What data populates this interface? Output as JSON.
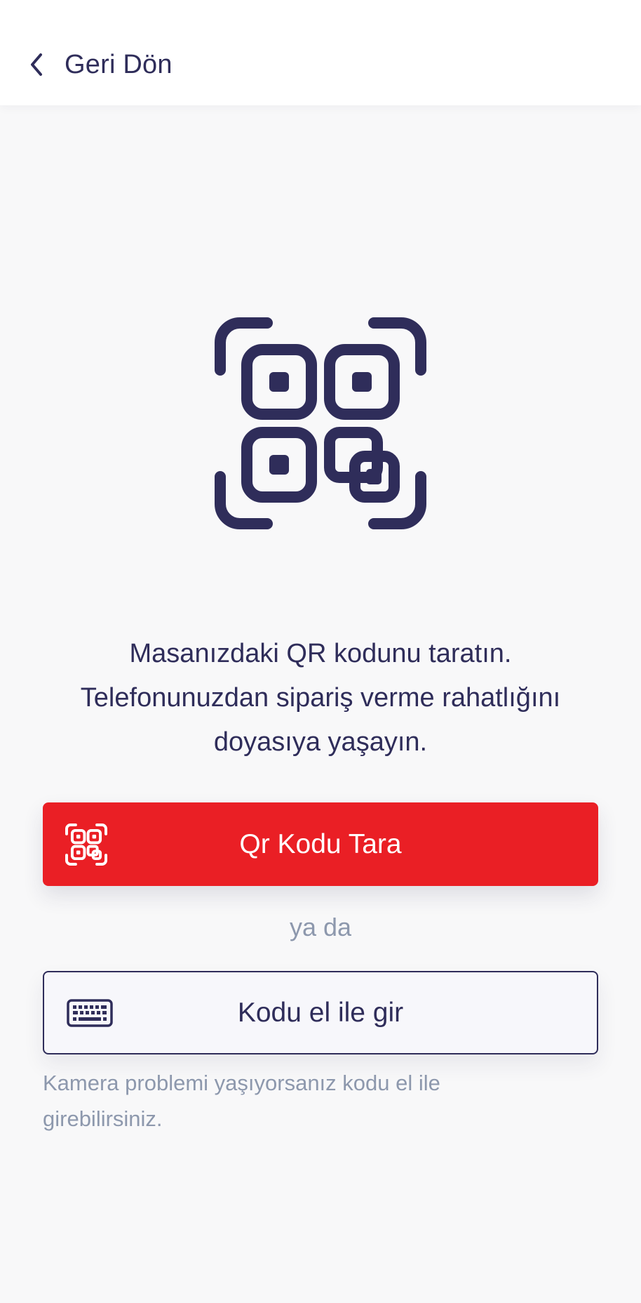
{
  "header": {
    "back_label": "Geri Dön",
    "back_icon": "chevron-left-icon"
  },
  "hero": {
    "icon": "qr-code-scan-icon"
  },
  "message": {
    "line1": "Masanızdaki QR kodunu taratın.",
    "line2": "Telefonunuzdan sipariş verme rahatlığını",
    "line3": "doyasıya yaşayın."
  },
  "scan_button": {
    "label": "Qr Kodu Tara",
    "icon": "qr-code-scan-icon",
    "color": "#ea1f25"
  },
  "separator": {
    "text": "ya da"
  },
  "manual_button": {
    "label": "Kodu el ile gir",
    "icon": "keyboard-icon"
  },
  "hint": {
    "text": "Kamera problemi yaşıyorsanız kodu el ile girebilirsiniz."
  },
  "colors": {
    "primary_text": "#2f2d5a",
    "accent": "#ea1f25",
    "muted_text": "#8d98ad",
    "background": "#f8f8f9"
  }
}
